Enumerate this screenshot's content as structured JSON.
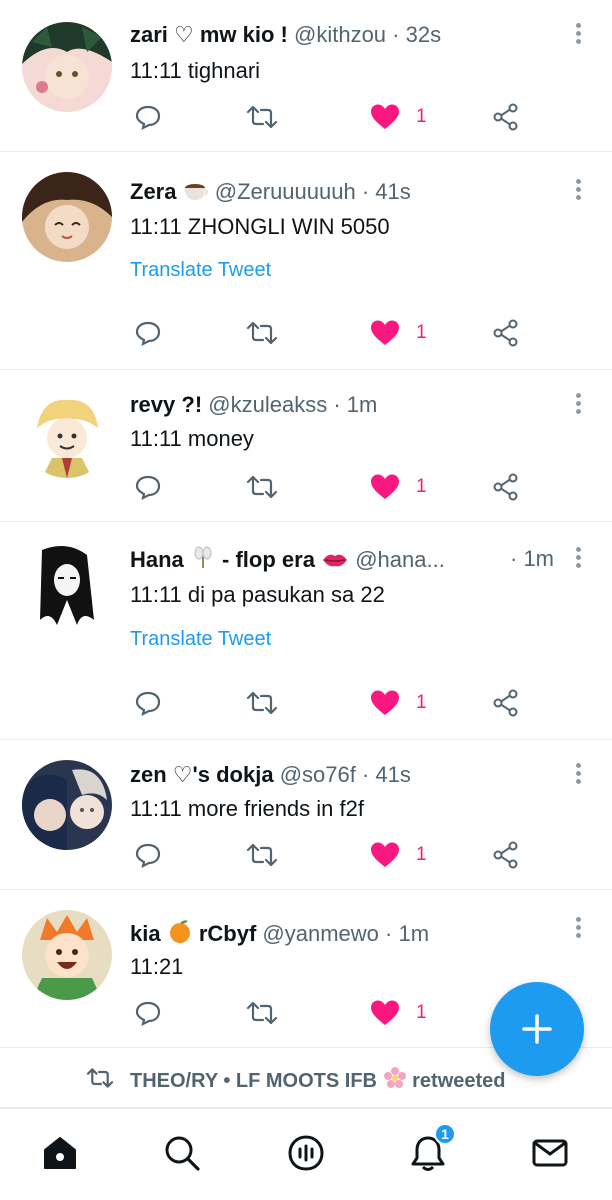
{
  "tweets": [
    {
      "name": "zari ♡ mw kio !",
      "handle": "@kithzou",
      "dot": "·",
      "time": "32s",
      "text": "11:11 tighnari",
      "likes": "1"
    },
    {
      "name": "Zera",
      "handle": "@Zeruuuuuuh",
      "dot": "·",
      "time": "41s",
      "text": "11:11 ZHONGLI WIN 5050",
      "translate": "Translate Tweet",
      "likes": "1"
    },
    {
      "name": "revy ?!",
      "handle": "@kzuleakss",
      "dot": "·",
      "time": "1m",
      "text": "11:11 money",
      "likes": "1"
    },
    {
      "name": "Hana",
      "name_suffix": "- flop era",
      "handle": "@hana...",
      "dot": "·",
      "time": "1m",
      "text": "11:11 di pa pasukan sa 22",
      "translate": "Translate Tweet",
      "likes": "1"
    },
    {
      "name": "zen ♡'s dokja",
      "handle": "@so76f",
      "dot": "·",
      "time": "41s",
      "text": "11:11 more friends in f2f",
      "likes": "1"
    },
    {
      "name": "kia",
      "name_suffix": "rCbyf",
      "handle": "@yanmewo",
      "dot": "·",
      "time": "1m",
      "text": "11:21",
      "likes": "1"
    }
  ],
  "retweet_notice": {
    "text": "THEO/RY • LF MOOTS IFB",
    "suffix": "retweeted"
  },
  "nav": {
    "items": [
      "home-icon",
      "search-icon",
      "spaces-icon",
      "notifications-icon",
      "messages-icon"
    ],
    "notification_count": "1"
  },
  "colors": {
    "accent": "#1d9bf0",
    "like": "#f91880",
    "muted": "#536471"
  }
}
